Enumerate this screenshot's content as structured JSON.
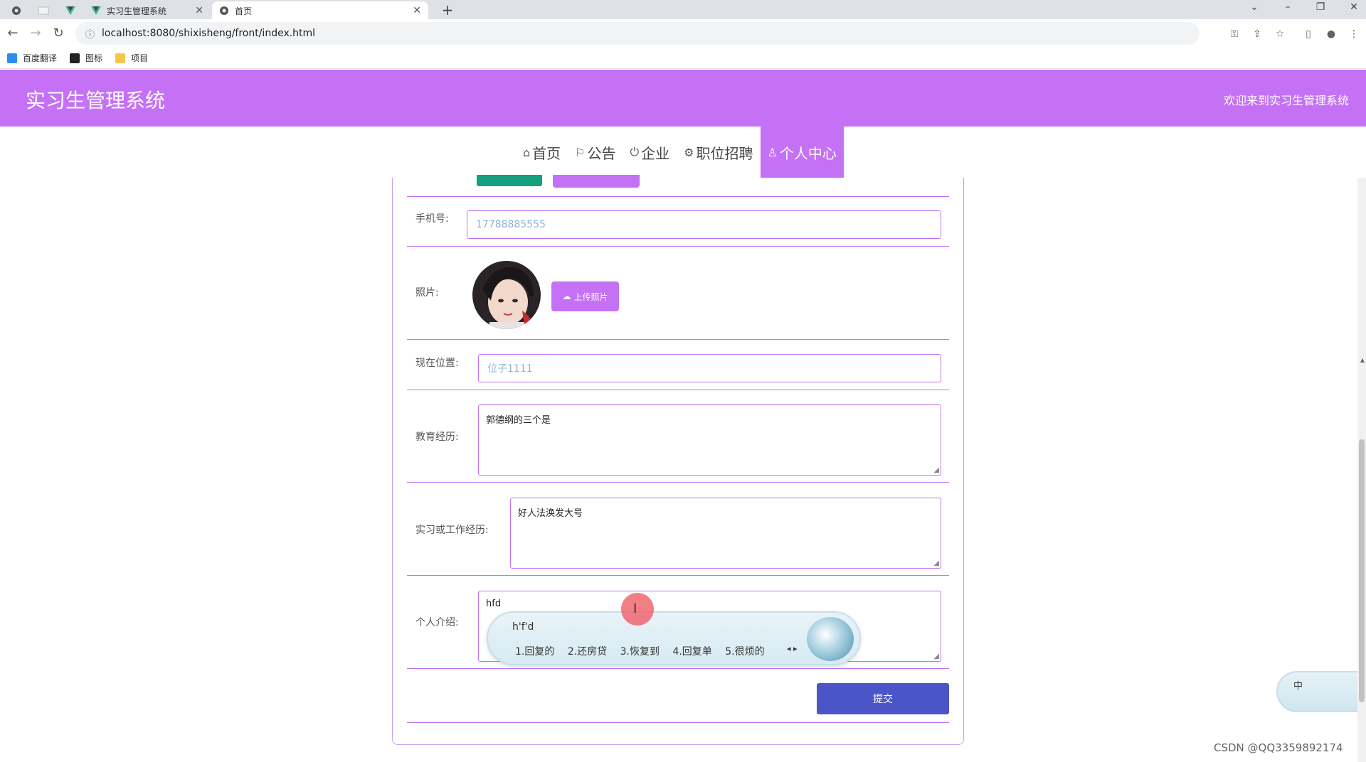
{
  "browser": {
    "tabs": [
      {
        "title": "实习生管理系统"
      },
      {
        "title": "首页"
      }
    ],
    "url": "localhost:8080/shixisheng/front/index.html",
    "bookmarks": [
      {
        "label": "百度翻译"
      },
      {
        "label": "图标"
      },
      {
        "label": "项目"
      }
    ]
  },
  "header": {
    "title": "实习生管理系统",
    "welcome": "欢迎来到实习生管理系统"
  },
  "nav": {
    "items": [
      {
        "label": "首页",
        "icon": "home-icon"
      },
      {
        "label": "公告",
        "icon": "flag-icon"
      },
      {
        "label": "企业",
        "icon": "power-icon"
      },
      {
        "label": "职位招聘",
        "icon": "gear-icon"
      },
      {
        "label": "个人中心",
        "icon": "user-icon",
        "active": true
      }
    ]
  },
  "form": {
    "phone": {
      "label": "手机号:",
      "value": "17788885555"
    },
    "photo": {
      "label": "照片:",
      "upload_label": "上传照片"
    },
    "location": {
      "label": "现在位置:",
      "value": "位子1111"
    },
    "education": {
      "label": "教育经历:",
      "value": "郭德纲的三个是"
    },
    "experience": {
      "label": "实习或工作经历:",
      "value": "好人法涣发大号"
    },
    "intro": {
      "label": "个人介绍:",
      "value": "hfd"
    },
    "submit_label": "提交"
  },
  "ime": {
    "pinyin": "h'f'd",
    "candidates": [
      "1.回复的",
      "2.还房贷",
      "3.恢复到",
      "4.回复单",
      "5.很烦的"
    ],
    "status": "中"
  },
  "watermark": "CSDN @QQ3359892174",
  "colors": {
    "accent": "#c471f5",
    "submit": "#4c55c7",
    "teal": "#17a07f"
  }
}
